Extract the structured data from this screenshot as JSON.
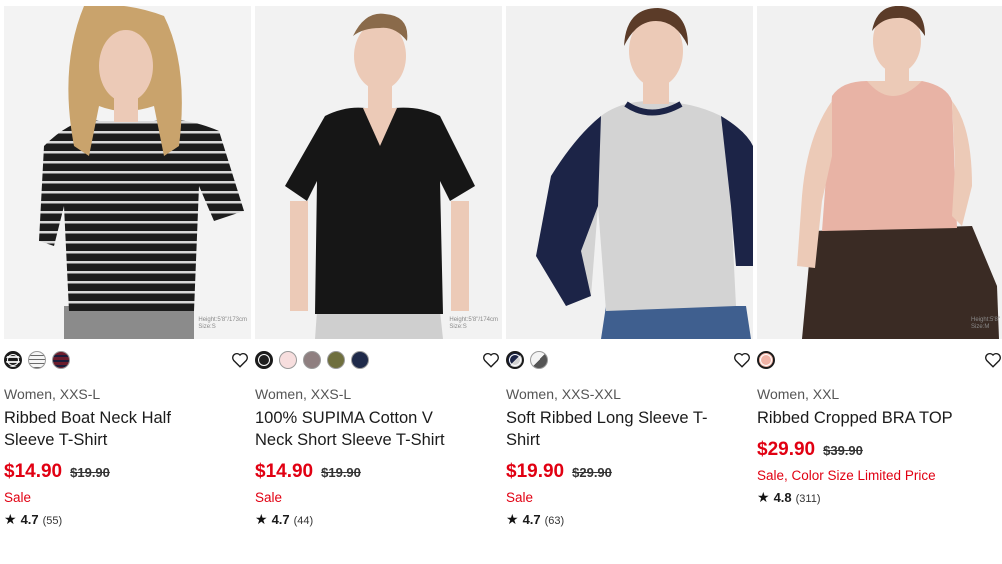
{
  "products": [
    {
      "fit": "Height:5'8\"/173cm\nSize:S",
      "fit1": "Height:5'8\"/173cm",
      "fit2": "Size:S",
      "meta": "Women, XXS-L",
      "title_l1": "Ribbed Boat Neck Half",
      "title_l2": "Sleeve T-Shirt",
      "price": "$14.90",
      "old_price": "$19.90",
      "promo": "Sale",
      "rating": "4.7",
      "reviews": "(55)"
    },
    {
      "fit1": "Height:5'8\"/174cm",
      "fit2": "Size:S",
      "meta": "Women, XXS-L",
      "title_l1": "100% SUPIMA Cotton V",
      "title_l2": "Neck Short Sleeve T-Shirt",
      "price": "$14.90",
      "old_price": "$19.90",
      "promo": "Sale",
      "rating": "4.7",
      "reviews": "(44)"
    },
    {
      "meta": "Women, XXS-XXL",
      "title_l1": "Soft Ribbed Long Sleeve T-",
      "title_l2": "Shirt",
      "price": "$19.90",
      "old_price": "$29.90",
      "promo": "Sale",
      "rating": "4.7",
      "reviews": "(63)"
    },
    {
      "fit1": "Height:5'8\"",
      "fit2": "Size:M",
      "meta": "Women, XXL",
      "title_l1": "Ribbed Cropped BRA TOP",
      "title_l2": "",
      "price": "$29.90",
      "old_price": "$39.90",
      "promo": "Sale, Color Size Limited Price",
      "rating": "4.8",
      "reviews": "(311)"
    }
  ],
  "colors": {
    "sale_red": "#e10012",
    "p1_swatches": [
      "stripe-black",
      "stripe-white",
      "stripe-wine"
    ],
    "p2_swatches": [
      "#1f1f1f",
      "#f7dede",
      "#8f7f80",
      "#6f6f3e",
      "#1f2a4a"
    ],
    "p3_swatches": [
      "raglan-navy",
      "raglan-gray"
    ],
    "p4_swatches": [
      "#f0b3a6"
    ]
  },
  "icons": {
    "wishlist": "heart-outline-icon",
    "rating": "star-icon"
  }
}
